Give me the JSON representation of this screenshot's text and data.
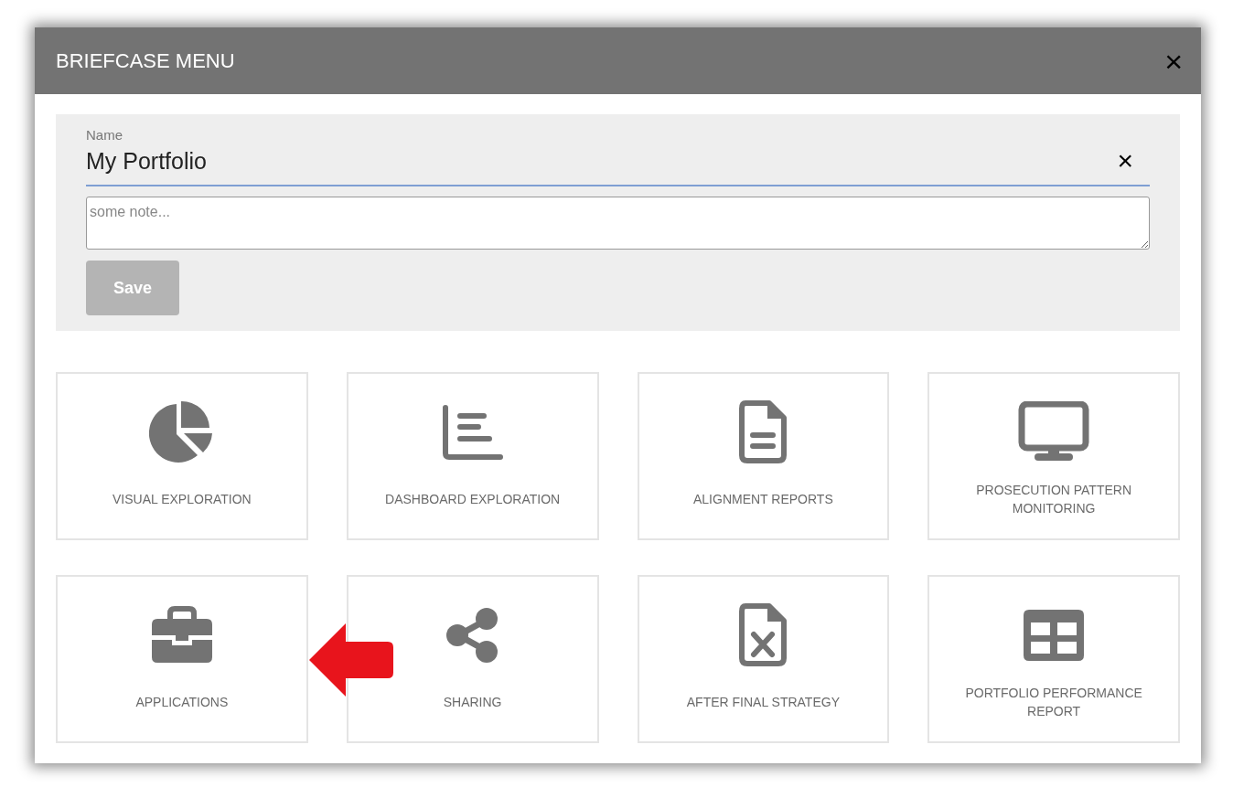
{
  "dialog": {
    "title": "BRIEFCASE MENU",
    "close": "×"
  },
  "form": {
    "name_label": "Name",
    "name_value": "My Portfolio",
    "clear": "×",
    "note_placeholder": "some note...",
    "save": {
      "label": "Save",
      "disabled": true
    }
  },
  "tiles": [
    {
      "label": "VISUAL EXPLORATION"
    },
    {
      "label": "DASHBOARD EXPLORATION"
    },
    {
      "label": "ALIGNMENT REPORTS"
    },
    {
      "label": "PROSECUTION PATTERN MONITORING"
    },
    {
      "label": "APPLICATIONS"
    },
    {
      "label": "SHARING"
    },
    {
      "label": "AFTER FINAL STRATEGY"
    },
    {
      "label": "PORTFOLIO PERFORMANCE REPORT"
    }
  ],
  "annotation": {
    "kind": "arrow",
    "color": "#e8141c"
  }
}
